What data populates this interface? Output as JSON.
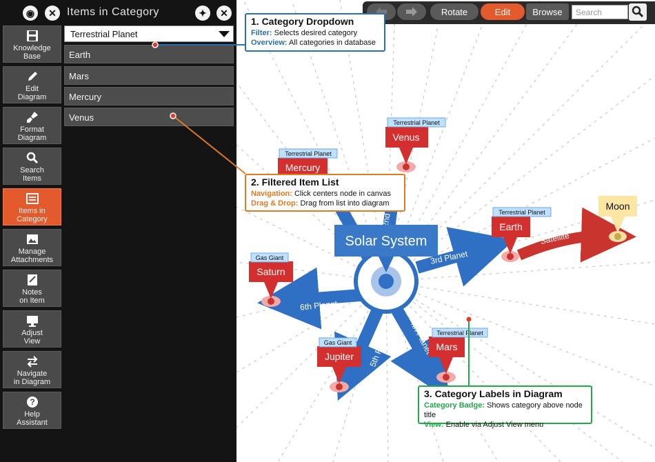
{
  "sidebar": {
    "panel_title": "Items in Category",
    "nav": [
      {
        "label1": "Knowledge",
        "label2": "Base"
      },
      {
        "label1": "Edit",
        "label2": "Diagram"
      },
      {
        "label1": "Format",
        "label2": "Diagram"
      },
      {
        "label1": "Search",
        "label2": "Items"
      },
      {
        "label1": "Items in",
        "label2": "Category"
      },
      {
        "label1": "Manage",
        "label2": "Attachments"
      },
      {
        "label1": "Notes",
        "label2": "on Item"
      },
      {
        "label1": "Adjust",
        "label2": "View"
      },
      {
        "label1": "Navigate",
        "label2": "in Diagram"
      },
      {
        "label1": "Help",
        "label2": "Assistant"
      }
    ],
    "dropdown_value": "Terrestrial Planet",
    "items": [
      "Earth",
      "Mars",
      "Mercury",
      "Venus"
    ]
  },
  "toolbar": {
    "rotate": "Rotate",
    "edit": "Edit",
    "browse": "Browse",
    "search_placeholder": "Search"
  },
  "callouts": {
    "c1": {
      "title": "1. Category Dropdown",
      "k1": "Filter:",
      "v1": "Selects desired category",
      "k2": "Overview:",
      "v2": "All categories in database"
    },
    "c2": {
      "title": "2. Filtered Item List",
      "k1": "Navigation:",
      "v1": "Click centers node in canvas",
      "k2": "Drag & Drop:",
      "v2": "Drag from list into diagram"
    },
    "c3": {
      "title": "3. Category Labels in Diagram",
      "k1": "Category Badge:",
      "v1": "Shows category above node title",
      "k2": "View:",
      "v2": "Enable via Adjust View menu"
    }
  },
  "diagram": {
    "center": "Solar System",
    "nodes": [
      {
        "title": "Venus",
        "badge": "Terrestrial Planet"
      },
      {
        "title": "Mercury",
        "badge": "Terrestrial Planet"
      },
      {
        "title": "Earth",
        "badge": "Terrestrial Planet"
      },
      {
        "title": "Moon",
        "badge": ""
      },
      {
        "title": "Saturn",
        "badge": "Gas Giant"
      },
      {
        "title": "Jupiter",
        "badge": "Gas Giant"
      },
      {
        "title": "Mars",
        "badge": "Terrestrial Planet"
      }
    ],
    "links": [
      "3rd Planet",
      "6th Planet",
      "5th Plane",
      "4th Planet",
      "Satellite",
      "1st Plan",
      "2nd Pl"
    ]
  },
  "colors": {
    "accent": "#e35a2d",
    "node_red": "#d32f2f",
    "link_blue": "#2f6fc4",
    "callout1": "#2b6fb3",
    "callout2": "#e07b24",
    "callout3": "#21a84b"
  }
}
